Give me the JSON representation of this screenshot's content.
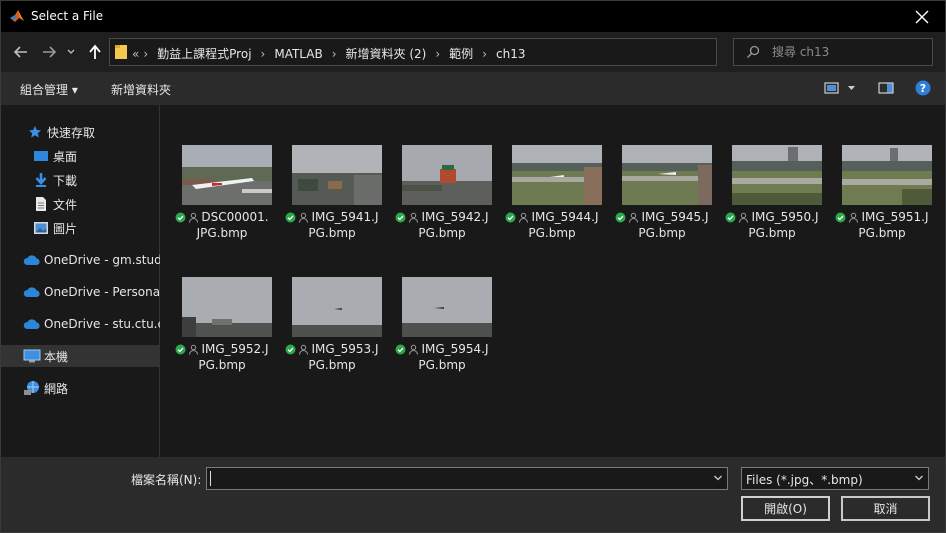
{
  "window": {
    "title": "Select a File"
  },
  "nav": {
    "path": [
      "勤益上課程式Proj",
      "MATLAB",
      "新增資料夾 (2)",
      "範例",
      "ch13"
    ],
    "overflow": "«",
    "separator": "›",
    "search_placeholder": "搜尋 ch13"
  },
  "toolbar": {
    "organize_label": "組合管理 ▾",
    "new_folder_label": "新增資料夾"
  },
  "sidebar": {
    "items": [
      {
        "label": "快速存取",
        "icon": "star-icon"
      },
      {
        "label": "桌面",
        "icon": "desktop-icon",
        "pinned": true
      },
      {
        "label": "下載",
        "icon": "download-icon",
        "pinned": true
      },
      {
        "label": "文件",
        "icon": "document-icon",
        "pinned": true
      },
      {
        "label": "圖片",
        "icon": "picture-icon",
        "pinned": true
      },
      {
        "label": "OneDrive - gm.stud",
        "icon": "cloud-icon"
      },
      {
        "label": "OneDrive - Personal",
        "icon": "cloud-icon"
      },
      {
        "label": "OneDrive - stu.ctu.e",
        "icon": "cloud-icon"
      },
      {
        "label": "本機",
        "icon": "computer-icon",
        "selected": true
      },
      {
        "label": "網路",
        "icon": "network-icon"
      }
    ]
  },
  "files": [
    {
      "line1": "DSC00001.",
      "line2": "JPG.bmp",
      "scene": "runway"
    },
    {
      "line1": "IMG_5941.J",
      "line2": "PG.bmp",
      "scene": "city"
    },
    {
      "line1": "IMG_5942.J",
      "line2": "PG.bmp",
      "scene": "hotel"
    },
    {
      "line1": "IMG_5944.J",
      "line2": "PG.bmp",
      "scene": "airfield"
    },
    {
      "line1": "IMG_5945.J",
      "line2": "PG.bmp",
      "scene": "airfield"
    },
    {
      "line1": "IMG_5950.J",
      "line2": "PG.bmp",
      "scene": "airfield"
    },
    {
      "line1": "IMG_5951.J",
      "line2": "PG.bmp",
      "scene": "airfield"
    },
    {
      "line1": "IMG_5952.J",
      "line2": "PG.bmp",
      "scene": "sky"
    },
    {
      "line1": "IMG_5953.J",
      "line2": "PG.bmp",
      "scene": "sky"
    },
    {
      "line1": "IMG_5954.J",
      "line2": "PG.bmp",
      "scene": "sky"
    }
  ],
  "footer": {
    "filename_label": "檔案名稱(N):",
    "filename_value": "",
    "filetype_value": "Files (*.jpg、*.bmp)",
    "open_label": "開啟(O)",
    "cancel_label": "取消"
  }
}
